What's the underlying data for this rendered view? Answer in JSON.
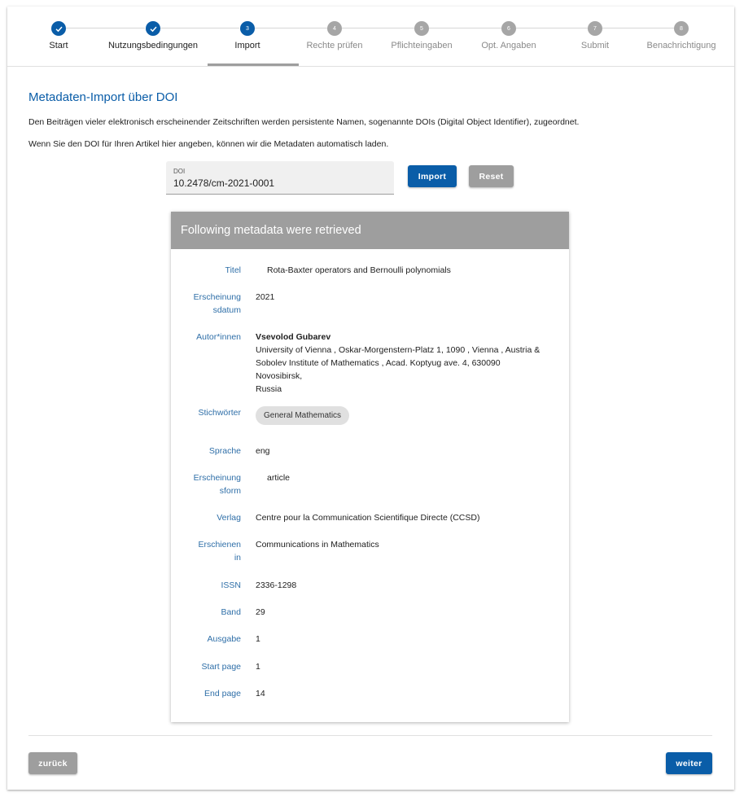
{
  "stepper": {
    "steps": [
      {
        "label": "Start",
        "number": "1",
        "state": "done"
      },
      {
        "label": "Nutzungsbedingungen",
        "number": "2",
        "state": "done"
      },
      {
        "label": "Import",
        "number": "3",
        "state": "active"
      },
      {
        "label": "Rechte prüfen",
        "number": "4",
        "state": "todo"
      },
      {
        "label": "Pflichteingaben",
        "number": "5",
        "state": "todo"
      },
      {
        "label": "Opt. Angaben",
        "number": "6",
        "state": "todo"
      },
      {
        "label": "Submit",
        "number": "7",
        "state": "todo"
      },
      {
        "label": "Benachrichtigung",
        "number": "8",
        "state": "todo"
      }
    ]
  },
  "main": {
    "heading": "Metadaten-Import über DOI",
    "intro": "Den Beiträgen vieler elektronisch erscheinender Zeitschriften werden persistente Namen, sogenannte DOIs (Digital Object Identifier), zugeordnet.",
    "hint": "Wenn Sie den DOI für Ihren Artikel hier angeben, können wir die Metadaten automatisch laden.",
    "doi_label": "DOI",
    "doi_value": "10.2478/cm-2021-0001",
    "import_label": "Import",
    "reset_label": "Reset"
  },
  "metadata": {
    "header": "Following metadata were retrieved",
    "title_label": "Titel",
    "title_value": "Rota-Baxter operators and Bernoulli polynomials",
    "date_label_1": "Erscheinung",
    "date_label_2": "sdatum",
    "date_value": "2021",
    "authors_label": "Autor*innen",
    "author_name": "Vsevolod Gubarev",
    "author_aff_1": "University of Vienna , Oskar-Morgenstern-Platz 1, 1090 , Vienna , Austria &",
    "author_aff_2": "Sobolev Institute of Mathematics , Acad. Koptyug ave. 4, 630090 Novosibirsk,",
    "author_aff_3": "Russia",
    "keywords_label": "Stichwörter",
    "keyword_1": "General Mathematics",
    "language_label": "Sprache",
    "language_value": "eng",
    "form_label_1": "Erscheinung",
    "form_label_2": "sform",
    "form_value": "article",
    "publisher_label": "Verlag",
    "publisher_value": "Centre pour la Communication Scientifique Directe (CCSD)",
    "published_in_label_1": "Erschienen",
    "published_in_label_2": "in",
    "published_in_value": "Communications in Mathematics",
    "issn_label": "ISSN",
    "issn_value": "2336-1298",
    "volume_label": "Band",
    "volume_value": "29",
    "issue_label": "Ausgabe",
    "issue_value": "1",
    "start_page_label": "Start page",
    "start_page_value": "1",
    "end_page_label": "End page",
    "end_page_value": "14"
  },
  "footer": {
    "back_label": "zurück",
    "next_label": "weiter"
  },
  "colors": {
    "primary": "#0a5da8",
    "secondary_button": "#9e9e9e",
    "label_blue": "#2f6fa8"
  }
}
